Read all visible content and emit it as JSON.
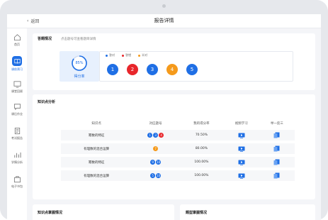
{
  "header": {
    "back_label": "返回",
    "title": "报告详情"
  },
  "sidebar": {
    "items": [
      {
        "label": "首页",
        "icon": "home-icon",
        "active": false
      },
      {
        "label": "课前预习",
        "icon": "book-icon",
        "active": true
      },
      {
        "label": "课堂回顾",
        "icon": "monitor-icon",
        "active": false
      },
      {
        "label": "课后作业",
        "icon": "chat-icon",
        "active": false
      },
      {
        "label": "考试报告",
        "icon": "exam-icon",
        "active": false
      },
      {
        "label": "学情分析",
        "icon": "analysis-icon",
        "active": false
      },
      {
        "label": "电子书包",
        "icon": "bag-icon",
        "active": false
      }
    ]
  },
  "answers": {
    "title": "答题情况",
    "hint": "点击题号可查看题目详情",
    "score_percent": "85%",
    "score_label": "得分率",
    "legend": [
      {
        "label": "答对",
        "color": "#1f6fe5"
      },
      {
        "label": "答错",
        "color": "#e8262b"
      },
      {
        "label": "半对",
        "color": "#f59a1b"
      }
    ],
    "questions": [
      {
        "num": "1",
        "color": "#1f6fe5"
      },
      {
        "num": "2",
        "color": "#e8262b"
      },
      {
        "num": "3",
        "color": "#1f6fe5"
      },
      {
        "num": "4",
        "color": "#f59a1b"
      },
      {
        "num": "5",
        "color": "#1f6fe5"
      }
    ]
  },
  "knowledge": {
    "title": "知识点分析",
    "columns": [
      "知识点",
      "对应题号",
      "我的得分率",
      "视频学习",
      "举一反三"
    ],
    "rows": [
      {
        "point": "幂数的特征",
        "badges": [
          {
            "n": "1",
            "c": "#1f6fe5"
          },
          {
            "n": "3",
            "c": "#1f6fe5"
          },
          {
            "n": "4",
            "c": "#e8262b"
          }
        ],
        "rate": "70.50%"
      },
      {
        "point": "有理数的混合运算",
        "badges": [
          {
            "n": "7",
            "c": "#f59a1b"
          }
        ],
        "rate": "80.00%"
      },
      {
        "point": "幂数的特征",
        "badges": [
          {
            "n": "9",
            "c": "#1f6fe5"
          },
          {
            "n": "10",
            "c": "#1f6fe5"
          }
        ],
        "rate": "100.00%"
      },
      {
        "point": "有理数的混合运算",
        "badges": [
          {
            "n": "5",
            "c": "#1f6fe5"
          },
          {
            "n": "10",
            "c": "#1f6fe5"
          }
        ],
        "rate": "100.00%"
      }
    ]
  },
  "bottom": {
    "left_title": "知识点掌握情况",
    "right_title": "题型掌握情况"
  }
}
